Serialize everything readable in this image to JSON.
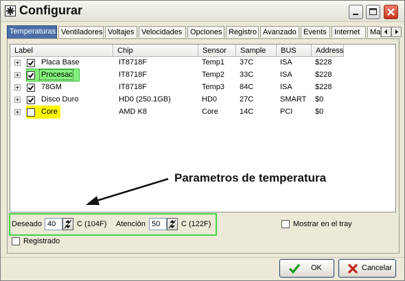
{
  "window": {
    "title": "Configurar",
    "icon": "app-gear-icon"
  },
  "tabs": [
    "Temperaturas",
    "Ventiladores",
    "Voltajes",
    "Velocidades",
    "Opciones",
    "Registro",
    "Avanzado",
    "Events",
    "Internet",
    "Ma"
  ],
  "active_tab": "Temperaturas",
  "table": {
    "columns": [
      "Label",
      "Chip",
      "Sensor",
      "Sample",
      "BUS",
      "Address"
    ],
    "rows": [
      {
        "label": "Placa Base",
        "chip": "IT8718F",
        "sensor": "Temp1",
        "sample": "37C",
        "bus": "ISA",
        "address": "$228",
        "checked": true
      },
      {
        "label": "Procesac",
        "chip": "IT8718F",
        "sensor": "Temp2",
        "sample": "33C",
        "bus": "ISA",
        "address": "$228",
        "checked": true
      },
      {
        "label": "78GM",
        "chip": "IT8718F",
        "sensor": "Temp3",
        "sample": "84C",
        "bus": "ISA",
        "address": "$228",
        "checked": true
      },
      {
        "label": "Disco Duro",
        "chip": "HD0 (250.1GB)",
        "sensor": "HD0",
        "sample": "27C",
        "bus": "SMART",
        "address": "$0",
        "checked": true
      },
      {
        "label": "Core",
        "chip": "AMD K8",
        "sensor": "Core",
        "sample": "14C",
        "bus": "PCI",
        "address": "$0",
        "checked": false
      }
    ]
  },
  "annotation": "Parametros de temperatura",
  "settings": {
    "desired_label": "Deseado",
    "desired_value": "40",
    "desired_unit": "C (104F)",
    "attention_label": "Atención",
    "attention_value": "50",
    "attention_unit": "C (122F)",
    "tray_label": "Mostrar en el tray",
    "registered_label": "Registrado"
  },
  "buttons": {
    "ok": "OK",
    "cancel": "Cancelar"
  },
  "colors": {
    "active_tab": "#4a6fa8",
    "highlight_green": "#82f27a",
    "highlight_yellow": "#fff700",
    "frame_green": "#41d441",
    "ok_icon": "#1a9b1a",
    "cancel_icon": "#c0241b"
  }
}
